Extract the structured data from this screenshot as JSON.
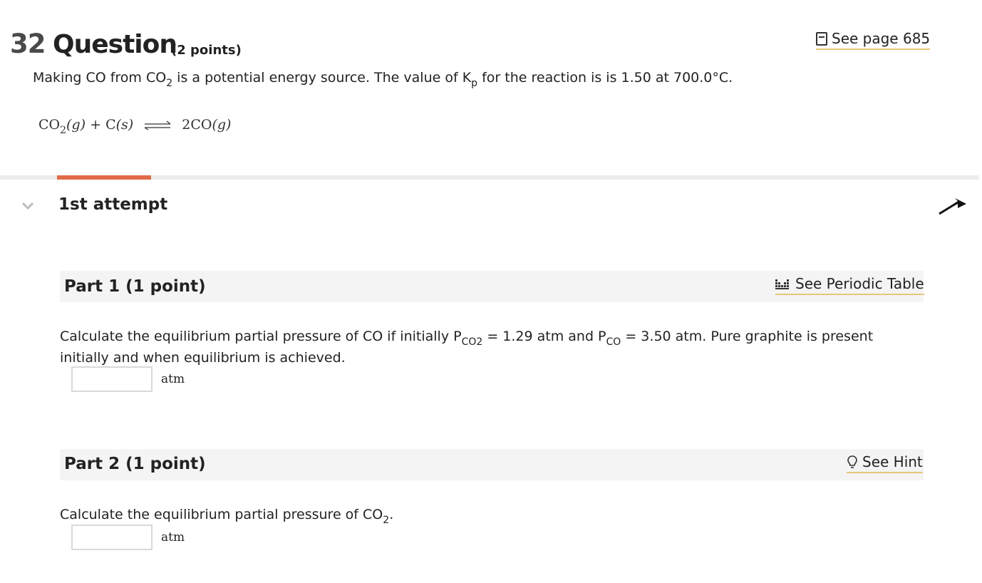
{
  "question": {
    "number": "32",
    "title": "Question",
    "points": "(2 points)",
    "see_page": "See page 685",
    "prompt_a": "Making CO from CO",
    "prompt_sub": "2",
    "prompt_b": " is a potential energy source. The value of K",
    "prompt_ksub": "p",
    "prompt_c": " for the reaction is is 1.50 at 700.0°C.",
    "equation": {
      "lhs1": "CO",
      "lhs1_sub": "2",
      "lhs1_state": "(g)",
      "plus": "+",
      "lhs2": "C",
      "lhs2_state": "(s)",
      "rhs": "2CO",
      "rhs_state": "(g)"
    }
  },
  "attempt": {
    "label": "1st attempt"
  },
  "part1": {
    "title": "Part 1   (1 point)",
    "link": "See Periodic Table",
    "text_a": "Calculate the equilibrium partial pressure of CO if initially P",
    "text_sub1": "CO2",
    "text_b": " = 1.29  atm and P",
    "text_sub2": "CO",
    "text_c": " = 3.50 atm. Pure graphite is present initially and when equilibrium is achieved.",
    "answer_value": "",
    "unit": "atm"
  },
  "part2": {
    "title": "Part 2   (1 point)",
    "link": "See Hint",
    "text_a": "Calculate the equilibrium partial pressure of CO",
    "text_sub": "2",
    "text_b": ".",
    "answer_value": "",
    "unit": "atm"
  },
  "colors": {
    "accent_tab": "#e06a4a",
    "link_underline": "#e7c77b",
    "part_bar": "#f4f4f4",
    "divider": "#ececec"
  },
  "icons": [
    "book-icon",
    "chevron-down-icon",
    "arrow-icon",
    "periodic-table-icon",
    "lightbulb-icon"
  ]
}
